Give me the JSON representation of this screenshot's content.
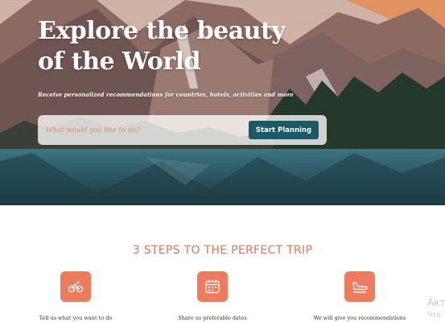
{
  "hero": {
    "title": "Explore the beauty of the World",
    "subtitle": "Receive personalized recommendations for countries, hotels, activities and more"
  },
  "search": {
    "placeholder": "What would you like to do?",
    "button_label": "Start Planning"
  },
  "steps": {
    "heading": "3 STEPS TO THE PERFECT TRIP",
    "items": [
      {
        "icon": "bicycle-icon",
        "label": "Tell us what you want to do"
      },
      {
        "icon": "calendar-icon",
        "label": "Share us preferable dates"
      },
      {
        "icon": "airplane-landing-icon",
        "label": "We will give you recommendations"
      }
    ]
  },
  "watermark": {
    "line1": "Акт",
    "line2": "Что"
  },
  "colors": {
    "accent": "#ee7b5e",
    "button": "#1c5966",
    "heading": "#e8755b"
  }
}
